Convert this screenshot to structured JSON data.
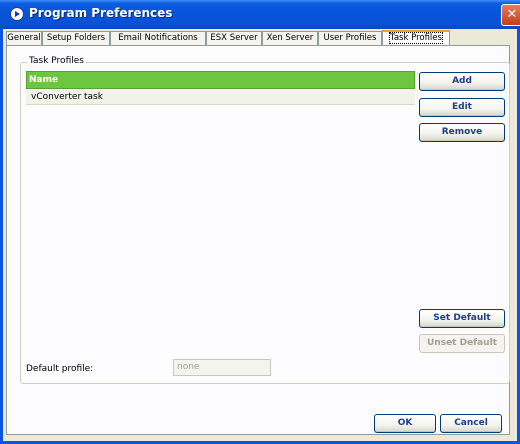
{
  "window": {
    "title": "Program Preferences",
    "close_glyph": "✕"
  },
  "tabs": [
    {
      "label": "General",
      "active": false
    },
    {
      "label": "Setup Folders",
      "active": false
    },
    {
      "label": "Email Notifications",
      "active": false
    },
    {
      "label": "ESX Server",
      "active": false
    },
    {
      "label": "Xen Server",
      "active": false
    },
    {
      "label": "User Profiles",
      "active": false
    },
    {
      "label": "Task Profiles",
      "active": true
    }
  ],
  "group": {
    "label": "Task Profiles"
  },
  "list": {
    "header": "Name",
    "rows": [
      "vConverter task"
    ]
  },
  "buttons": {
    "add": "Add",
    "edit": "Edit",
    "remove": "Remove",
    "set_default": "Set Default",
    "unset_default": "Unset Default",
    "ok": "OK",
    "cancel": "Cancel"
  },
  "default_profile": {
    "label": "Default profile:",
    "value": "none"
  },
  "colors": {
    "titlebar": "#0754DA",
    "list_header": "#6DC63F",
    "active_tab_accent": "#F2A027",
    "button_text": "#1E3F8C"
  }
}
